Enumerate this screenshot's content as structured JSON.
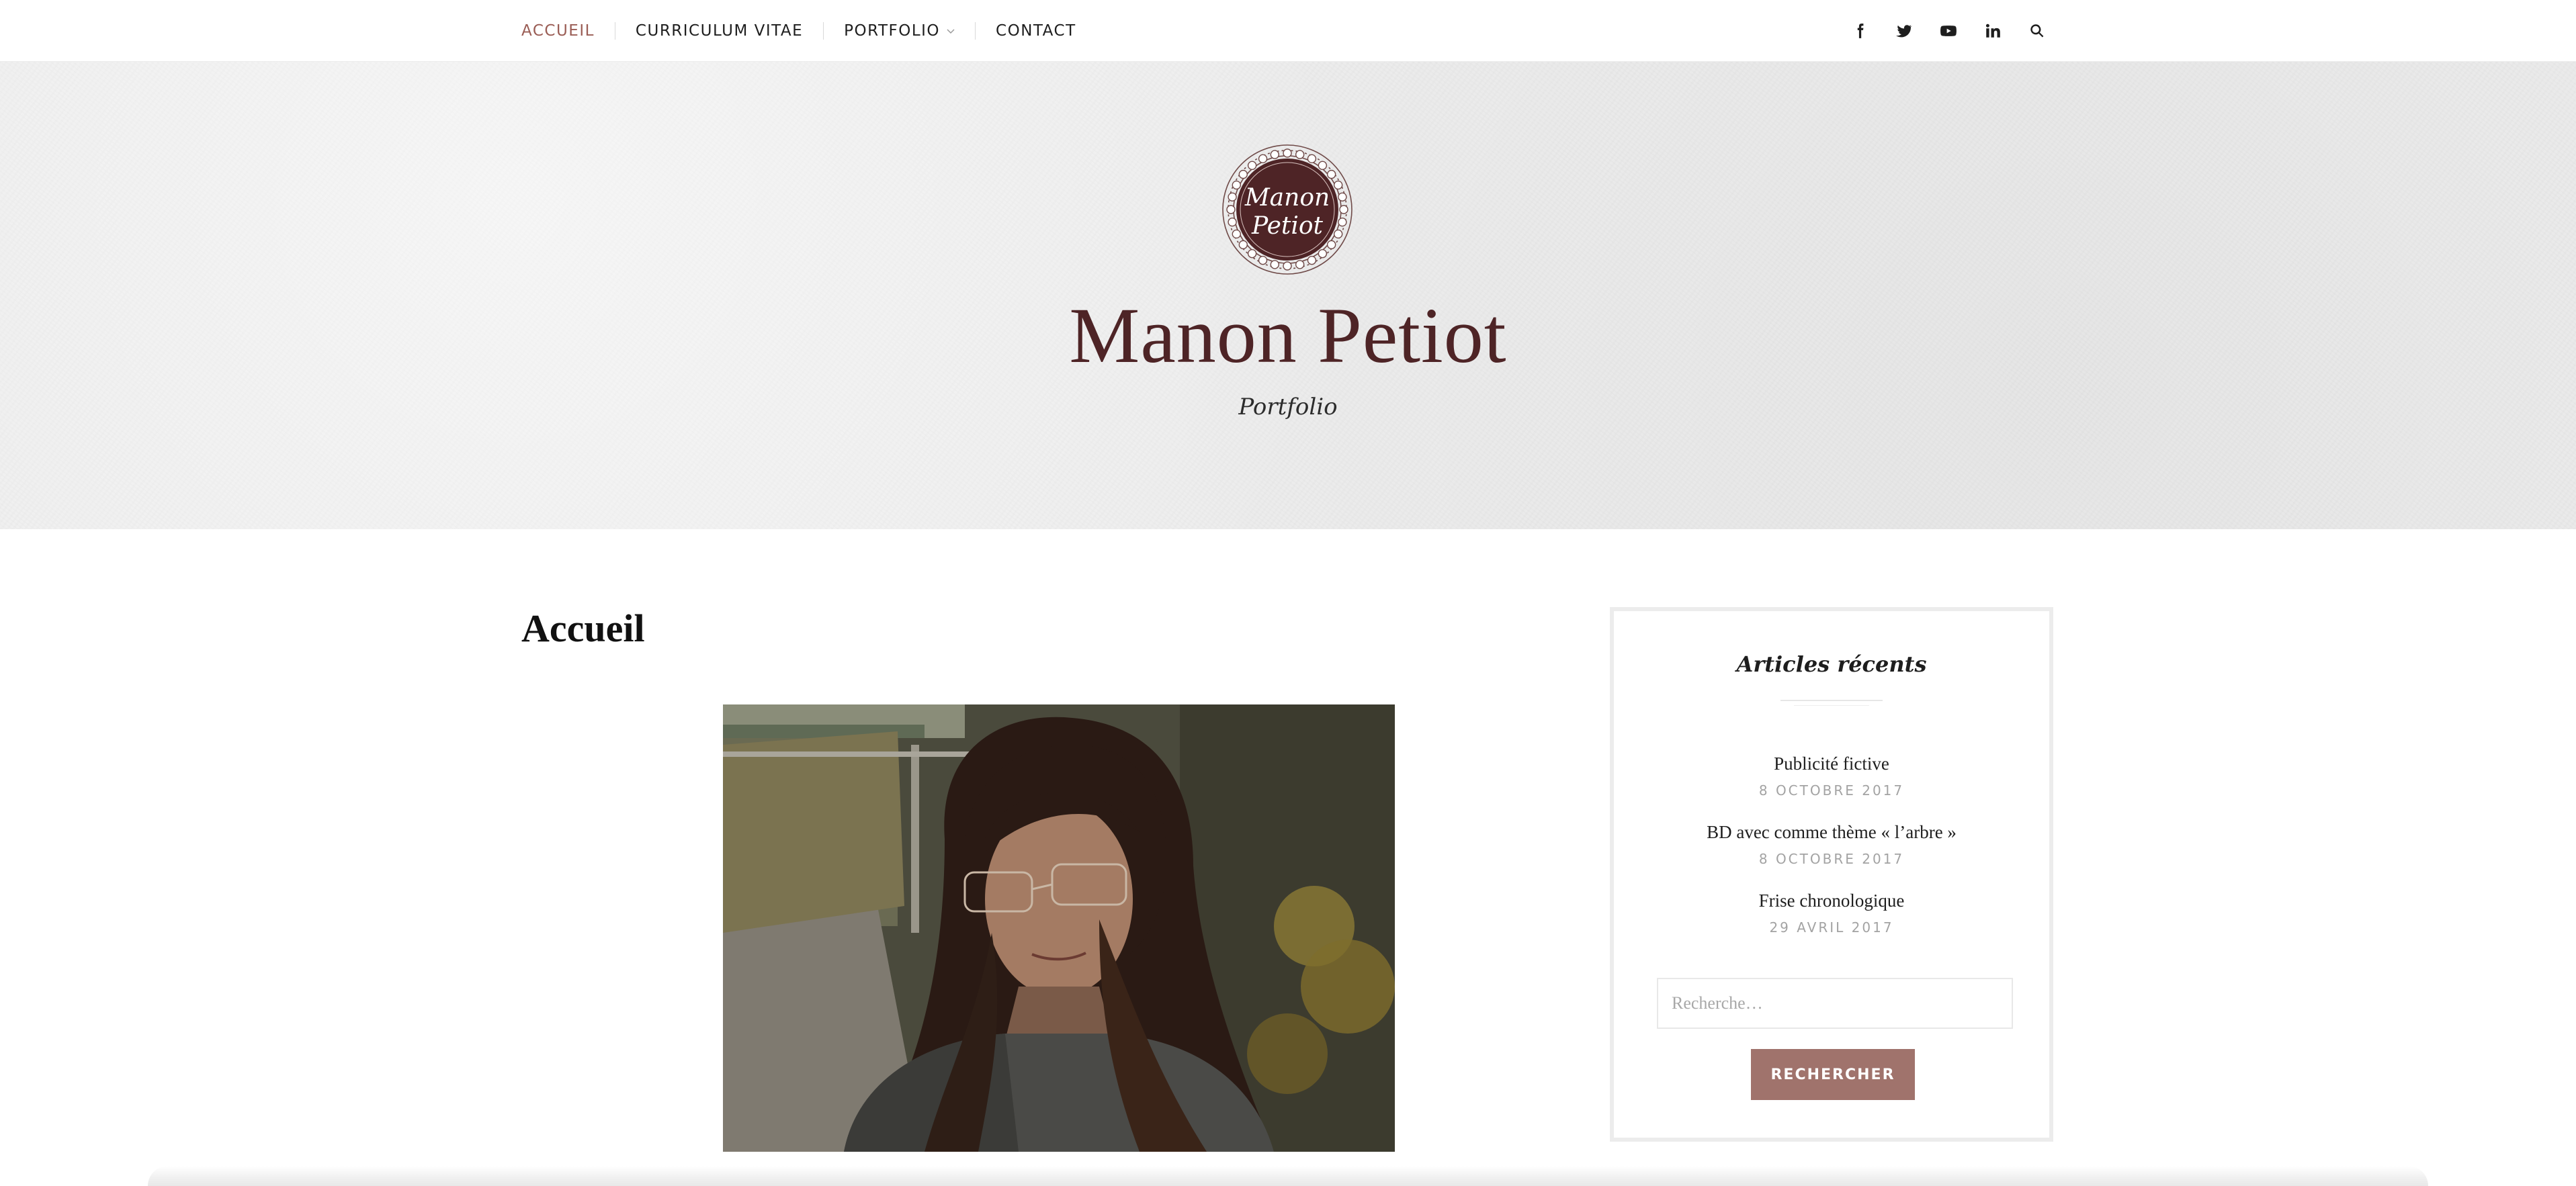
{
  "nav": {
    "items": [
      {
        "label": "ACCUEIL",
        "active": true
      },
      {
        "label": "CURRICULUM VITAE",
        "active": false
      },
      {
        "label": "PORTFOLIO",
        "active": false,
        "has_dropdown": true
      },
      {
        "label": "CONTACT",
        "active": false
      }
    ],
    "social_icons": [
      "facebook-icon",
      "twitter-icon",
      "youtube-icon",
      "linkedin-icon",
      "search-icon"
    ],
    "active_color": "#9a5d55"
  },
  "header": {
    "logo_text_line1": "Manon",
    "logo_text_line2": "Petiot",
    "site_title": "Manon Petiot",
    "tagline": "Portfolio",
    "title_color": "#4e2426"
  },
  "main": {
    "page_title": "Accueil",
    "photo_icon": "portrait-photo"
  },
  "sidebar": {
    "widget_title": "Articles récents",
    "posts": [
      {
        "title": "Publicité fictive",
        "date": "8 OCTOBRE 2017"
      },
      {
        "title": "BD avec comme thème « l’arbre »",
        "date": "8 OCTOBRE 2017"
      },
      {
        "title": "Frise chronologique",
        "date": "29 AVRIL 2017"
      }
    ],
    "search_placeholder": "Recherche…",
    "search_button": "RECHERCHER",
    "button_color": "#a0736c"
  }
}
